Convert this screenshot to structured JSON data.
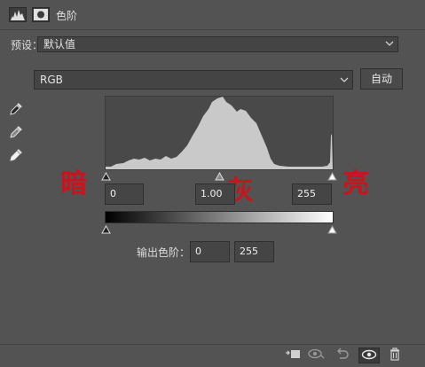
{
  "header": {
    "title": "色阶",
    "levels_icon": "levels-icon",
    "mask_icon": "mask-icon"
  },
  "preset": {
    "label": "预设：",
    "value": "默认值"
  },
  "channel": {
    "value": "RGB"
  },
  "auto_button": {
    "label": "自动"
  },
  "eyedroppers": [
    "black-point-eyedropper-icon",
    "gray-point-eyedropper-icon",
    "white-point-eyedropper-icon"
  ],
  "input_levels": {
    "black": "0",
    "gamma": "1.00",
    "white": "255"
  },
  "annotations": {
    "dark": "暗",
    "gray": "灰",
    "bright": "亮"
  },
  "output_levels": {
    "label": "输出色阶：",
    "black": "0",
    "white": "255"
  },
  "status_icons": [
    "clip-to-layer-icon",
    "view-previous-icon",
    "reset-icon",
    "visibility-eye-icon",
    "trash-icon"
  ],
  "colors": {
    "panel_bg": "#535353",
    "annotation_red": "#c8141c",
    "histogram_fill": "#c9c9c9"
  }
}
